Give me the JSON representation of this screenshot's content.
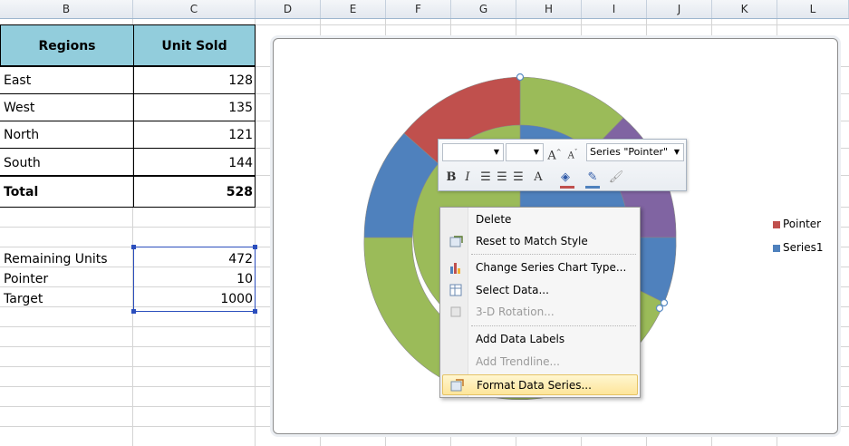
{
  "columns": [
    "B",
    "C",
    "D",
    "E",
    "F",
    "G",
    "H",
    "I",
    "J",
    "K",
    "L"
  ],
  "table": {
    "header": [
      "Regions",
      "Unit Sold"
    ],
    "rows": [
      {
        "region": "East",
        "units": "128"
      },
      {
        "region": "West",
        "units": "135"
      },
      {
        "region": "North",
        "units": "121"
      },
      {
        "region": "South",
        "units": "144"
      }
    ],
    "total": {
      "label": "Total",
      "units": "528"
    }
  },
  "params": [
    {
      "label": "Remaining Units",
      "value": "472"
    },
    {
      "label": "Pointer",
      "value": "10"
    },
    {
      "label": "Target",
      "value": "1000"
    }
  ],
  "chart": {
    "legend": [
      {
        "name": "Pointer",
        "color": "#c0504d"
      },
      {
        "name": "Series1",
        "color": "#4f81bd"
      }
    ],
    "colors": {
      "green": "#9bbb59",
      "blue": "#4f81bd",
      "red": "#c0504d",
      "purple": "#8064a2"
    }
  },
  "mini_toolbar": {
    "series_select": "Series \"Pointer\"",
    "bold": "B",
    "italic": "I",
    "grow_font": "A",
    "shrink_font": "A"
  },
  "context_menu": [
    {
      "label": "Delete",
      "icon": "",
      "disabled": false
    },
    {
      "label": "Reset to Match Style",
      "icon": "reset-style-icon",
      "disabled": false
    },
    {
      "label": "Change Series Chart Type...",
      "icon": "chart-type-icon",
      "disabled": false
    },
    {
      "label": "Select Data...",
      "icon": "select-data-icon",
      "disabled": false
    },
    {
      "label": "3-D Rotation...",
      "icon": "rotation-3d-icon",
      "disabled": true
    },
    {
      "label": "Add Data Labels",
      "icon": "",
      "disabled": false
    },
    {
      "label": "Add Trendline...",
      "icon": "",
      "disabled": true
    },
    {
      "label": "Format Data Series...",
      "icon": "format-series-icon",
      "disabled": false
    }
  ]
}
